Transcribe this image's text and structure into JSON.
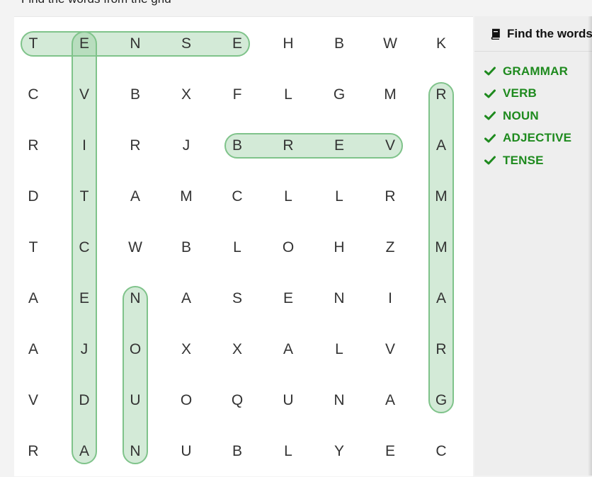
{
  "instruction": "Find the words from the grid",
  "grid": [
    [
      "T",
      "E",
      "N",
      "S",
      "E",
      "H",
      "B",
      "W",
      "K"
    ],
    [
      "C",
      "V",
      "B",
      "X",
      "F",
      "L",
      "G",
      "M",
      "R"
    ],
    [
      "R",
      "I",
      "R",
      "J",
      "B",
      "R",
      "E",
      "V",
      "A"
    ],
    [
      "D",
      "T",
      "A",
      "M",
      "C",
      "L",
      "L",
      "R",
      "M"
    ],
    [
      "T",
      "C",
      "W",
      "B",
      "L",
      "O",
      "H",
      "Z",
      "M"
    ],
    [
      "A",
      "E",
      "N",
      "A",
      "S",
      "E",
      "N",
      "I",
      "A"
    ],
    [
      "A",
      "J",
      "O",
      "X",
      "X",
      "A",
      "L",
      "V",
      "R"
    ],
    [
      "V",
      "D",
      "U",
      "O",
      "Q",
      "U",
      "N",
      "A",
      "G"
    ],
    [
      "R",
      "A",
      "N",
      "U",
      "B",
      "L",
      "Y",
      "E",
      "C"
    ]
  ],
  "found_words": [
    {
      "word": "TENSE",
      "start": [
        0,
        0
      ],
      "end": [
        0,
        4
      ]
    },
    {
      "word": "ADJECTIVE",
      "start": [
        8,
        1
      ],
      "end": [
        0,
        1
      ]
    },
    {
      "word": "VERB",
      "start": [
        2,
        7
      ],
      "end": [
        2,
        4
      ]
    },
    {
      "word": "GRAMMAR",
      "start": [
        7,
        8
      ],
      "end": [
        1,
        8
      ]
    },
    {
      "word": "NOUN",
      "start": [
        5,
        2
      ],
      "end": [
        8,
        2
      ]
    }
  ],
  "sidebar": {
    "title": "Find the words",
    "title_icon": "book-icon",
    "check_icon": "check-icon",
    "words": [
      "GRAMMAR",
      "VERB",
      "NOUN",
      "ADJECTIVE",
      "TENSE"
    ]
  },
  "colors": {
    "found_text": "#1e8a1e",
    "highlight_fill": "#cfe8d3",
    "highlight_border": "#7fc38a"
  }
}
